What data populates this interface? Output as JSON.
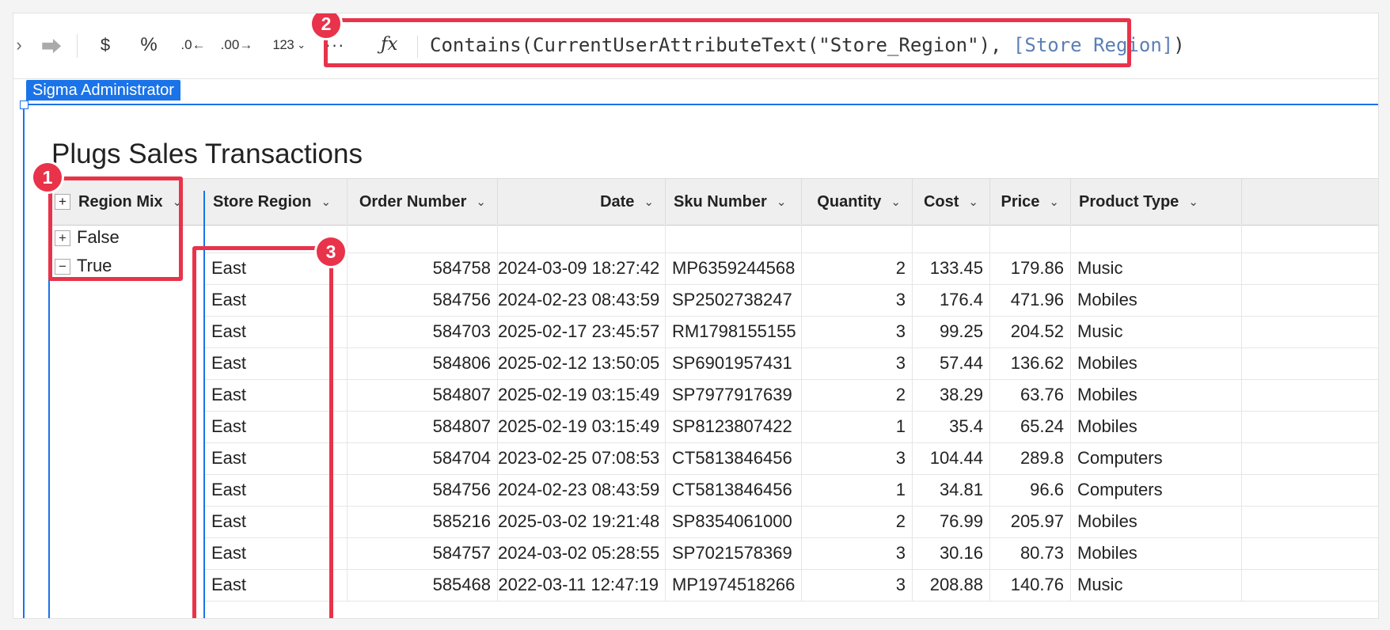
{
  "toolbar": {
    "redo_icon": "redo-arrow",
    "currency_label": "$",
    "percent_label": "%",
    "decrease_decimals_label": ".0",
    "increase_decimals_label": ".00",
    "number_format_label": "123",
    "more_label": "···"
  },
  "formula": {
    "fx_label": "ƒx",
    "prefix": "Contains(CurrentUserAttributeText(\"Store_Region\"), ",
    "ref": "[Store Region]",
    "suffix": ")"
  },
  "user_tag": "Sigma Administrator",
  "table_title": "Plugs Sales Transactions",
  "grouping": {
    "column": "Region Mix",
    "groups": [
      {
        "label": "False",
        "toggle": "+"
      },
      {
        "label": "True",
        "toggle": "−"
      }
    ]
  },
  "columns": [
    "Store Region",
    "Order Number",
    "Date",
    "Sku Number",
    "Quantity",
    "Cost",
    "Price",
    "Product Type"
  ],
  "rows": [
    [
      "East",
      "584758",
      "2024-03-09 18:27:42",
      "MP6359244568",
      "2",
      "133.45",
      "179.86",
      "Music"
    ],
    [
      "East",
      "584756",
      "2024-02-23 08:43:59",
      "SP2502738247",
      "3",
      "176.4",
      "471.96",
      "Mobiles"
    ],
    [
      "East",
      "584703",
      "2025-02-17 23:45:57",
      "RM1798155155",
      "3",
      "99.25",
      "204.52",
      "Music"
    ],
    [
      "East",
      "584806",
      "2025-02-12 13:50:05",
      "SP6901957431",
      "3",
      "57.44",
      "136.62",
      "Mobiles"
    ],
    [
      "East",
      "584807",
      "2025-02-19 03:15:49",
      "SP7977917639",
      "2",
      "38.29",
      "63.76",
      "Mobiles"
    ],
    [
      "East",
      "584807",
      "2025-02-19 03:15:49",
      "SP8123807422",
      "1",
      "35.4",
      "65.24",
      "Mobiles"
    ],
    [
      "East",
      "584704",
      "2023-02-25 07:08:53",
      "CT5813846456",
      "3",
      "104.44",
      "289.8",
      "Computers"
    ],
    [
      "East",
      "584756",
      "2024-02-23 08:43:59",
      "CT5813846456",
      "1",
      "34.81",
      "96.6",
      "Computers"
    ],
    [
      "East",
      "585216",
      "2025-03-02 19:21:48",
      "SP8354061000",
      "2",
      "76.99",
      "205.97",
      "Mobiles"
    ],
    [
      "East",
      "584757",
      "2024-03-02 05:28:55",
      "SP7021578369",
      "3",
      "30.16",
      "80.73",
      "Mobiles"
    ],
    [
      "East",
      "585468",
      "2022-03-11 12:47:19",
      "MP1974518266",
      "3",
      "208.88",
      "140.76",
      "Music"
    ]
  ],
  "annotations": {
    "badge_1": "1",
    "badge_2": "2",
    "badge_3": "3",
    "highlight_color": "#e8334a"
  },
  "colors": {
    "selection_blue": "#1a73e8",
    "formula_ref": "#5b7fb5"
  }
}
